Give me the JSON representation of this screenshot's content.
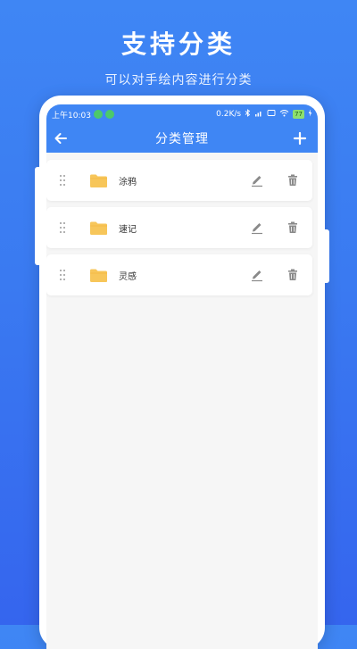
{
  "promo": {
    "title": "支持分类",
    "subtitle": "可以对手绘内容进行分类"
  },
  "status_bar": {
    "time": "上午10:03",
    "speed": "0.2K/s",
    "battery": "77"
  },
  "toolbar": {
    "title": "分类管理",
    "back_icon": "arrow-left-icon",
    "add_icon": "plus-icon"
  },
  "categories": [
    {
      "label": "涂鸦"
    },
    {
      "label": "速记"
    },
    {
      "label": "灵感"
    }
  ],
  "colors": {
    "accent": "#3f86f4",
    "folder": "#f7c65a",
    "icon_gray": "#8a8a8a"
  }
}
